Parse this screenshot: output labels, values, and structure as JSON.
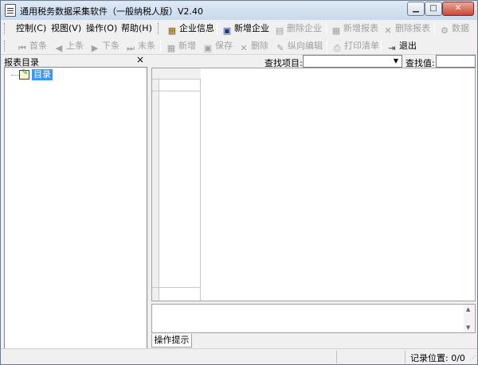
{
  "window": {
    "title": "通用税务数据采集软件（一般纳税人版）V2.40",
    "min_symbol": "▁",
    "max_symbol": "□",
    "close_symbol": "✕"
  },
  "menu": {
    "items": [
      "控制(C)",
      "视图(V)",
      "操作(O)",
      "帮助(H)"
    ]
  },
  "toolbar1": {
    "company_info": "企业信息",
    "new_company": "新增企业",
    "delete_company": "删除企业",
    "new_report": "新增报表",
    "delete_report": "删除报表",
    "data": "数据"
  },
  "toolbar2": {
    "first": "首条",
    "prev": "上条",
    "next": "下条",
    "last": "末条",
    "add": "新增",
    "save": "保存",
    "delete": "删除",
    "vertical_edit": "纵向编辑",
    "print_list": "打印清单",
    "exit": "退出"
  },
  "left_panel": {
    "title": "报表目录",
    "close_symbol": "×",
    "tree_root": "目录"
  },
  "search": {
    "field_label": "查找项目:",
    "value_label": "查找值:",
    "field_value": "",
    "value_value": ""
  },
  "hint": {
    "tab_label": "操作提示",
    "content": ""
  },
  "statusbar": {
    "record_position": "记录位置: 0/0"
  },
  "icons": {
    "app": "document-icon",
    "company_info": "building-icon",
    "new_company": "new-company-icon",
    "exit": "exit-door-icon"
  }
}
